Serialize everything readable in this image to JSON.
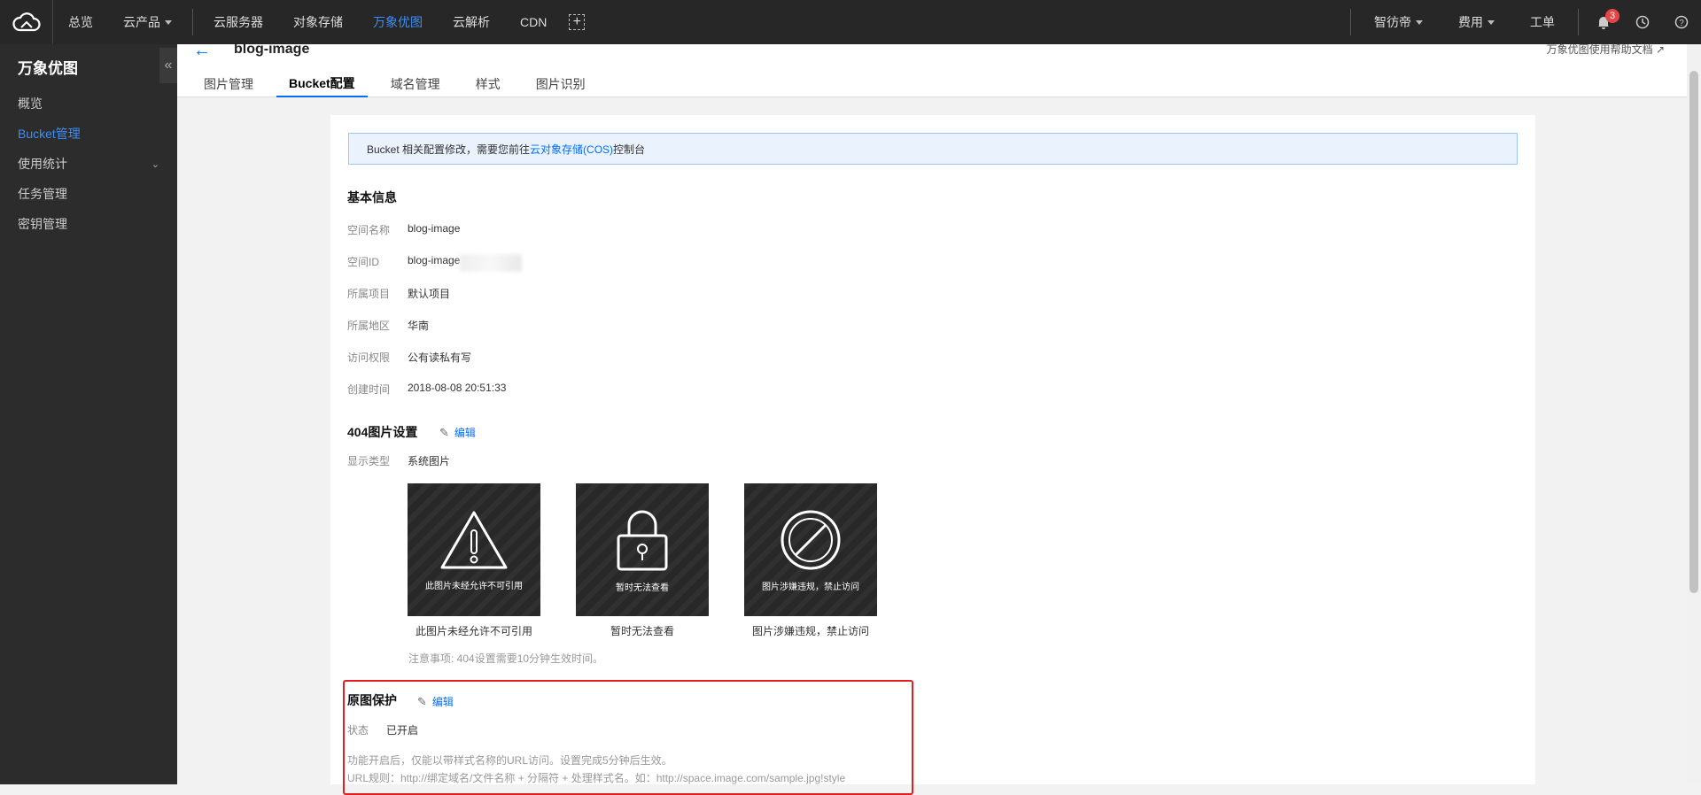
{
  "topbar": {
    "nav": [
      "总览",
      "云产品",
      "云服务器",
      "对象存储",
      "万象优图",
      "云解析",
      "CDN"
    ],
    "active_nav": "万象优图",
    "user": "智彷帝",
    "billing": "费用",
    "tickets": "工单",
    "notification_count": "3"
  },
  "sidebar": {
    "title": "万象优图",
    "items": [
      {
        "label": "概览"
      },
      {
        "label": "Bucket管理"
      },
      {
        "label": "使用统计"
      },
      {
        "label": "任务管理"
      },
      {
        "label": "密钥管理"
      }
    ],
    "collapse_glyph": "«"
  },
  "header": {
    "back_glyph": "←",
    "title": "blog-image",
    "help_link": "万象优图使用帮助文档",
    "tabs": [
      "图片管理",
      "Bucket配置",
      "域名管理",
      "样式",
      "图片识别"
    ]
  },
  "notice": {
    "prefix": "Bucket 相关配置修改，需要您前往",
    "link": "云对象存储(COS)",
    "suffix": "控制台"
  },
  "basic_info": {
    "title": "基本信息",
    "rows": [
      {
        "k": "空间名称",
        "v": "blog-image"
      },
      {
        "k": "空间ID",
        "v": "blog-image"
      },
      {
        "k": "所属项目",
        "v": "默认项目"
      },
      {
        "k": "所属地区",
        "v": "华南"
      },
      {
        "k": "访问权限",
        "v": "公有读私有写"
      },
      {
        "k": "创建时间",
        "v": "2018-08-08 20:51:33"
      }
    ]
  },
  "img404": {
    "title": "404图片设置",
    "edit": "编辑",
    "type_label": "显示类型",
    "type_value": "系统图片",
    "cards": [
      {
        "inner": "此图片未经允许不可引用",
        "caption": "此图片未经允许不可引用",
        "icon": "warning-triangle-icon"
      },
      {
        "inner": "暂时无法查看",
        "caption": "暂时无法查看",
        "icon": "padlock-icon"
      },
      {
        "inner": "图片涉嫌违规，禁止访问",
        "caption": "图片涉嫌违规，禁止访问",
        "icon": "forbidden-icon"
      }
    ],
    "hint": "注意事项: 404设置需要10分钟生效时间。"
  },
  "protect": {
    "title": "原图保护",
    "edit": "编辑",
    "status_label": "状态",
    "status_value": "已开启",
    "desc1": "功能开启后，仅能以带样式名称的URL访问。设置完成5分钟后生效。",
    "desc2": "URL规则：http://绑定域名/文件名称 + 分隔符 + 处理样式名。如：http://space.image.com/sample.jpg!style"
  },
  "colors": {
    "accent": "#006eff",
    "highlight_border": "#e02020",
    "topbar": "#272727",
    "sidebar": "#2c2c2c"
  }
}
